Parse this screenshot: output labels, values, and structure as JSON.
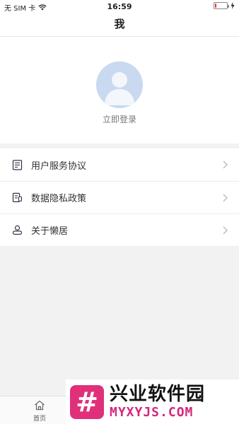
{
  "status_bar": {
    "carrier": "无 SIM 卡",
    "time": "16:59",
    "battery_level": 0.1,
    "battery_color": "#e33333"
  },
  "nav": {
    "title": "我"
  },
  "profile": {
    "login_label": "立即登录",
    "avatar_icon": "default-avatar-icon"
  },
  "menu": {
    "items": [
      {
        "label": "用户服务协议",
        "icon": "document-list-icon"
      },
      {
        "label": "数据隐私政策",
        "icon": "privacy-document-icon"
      },
      {
        "label": "关于懒居",
        "icon": "person-icon"
      }
    ]
  },
  "tabbar": {
    "home_label": "首页",
    "home_icon": "home-icon"
  },
  "watermark": {
    "title": "兴业软件园",
    "url": "MYXYJS.COM",
    "logo_glyph": "#"
  }
}
